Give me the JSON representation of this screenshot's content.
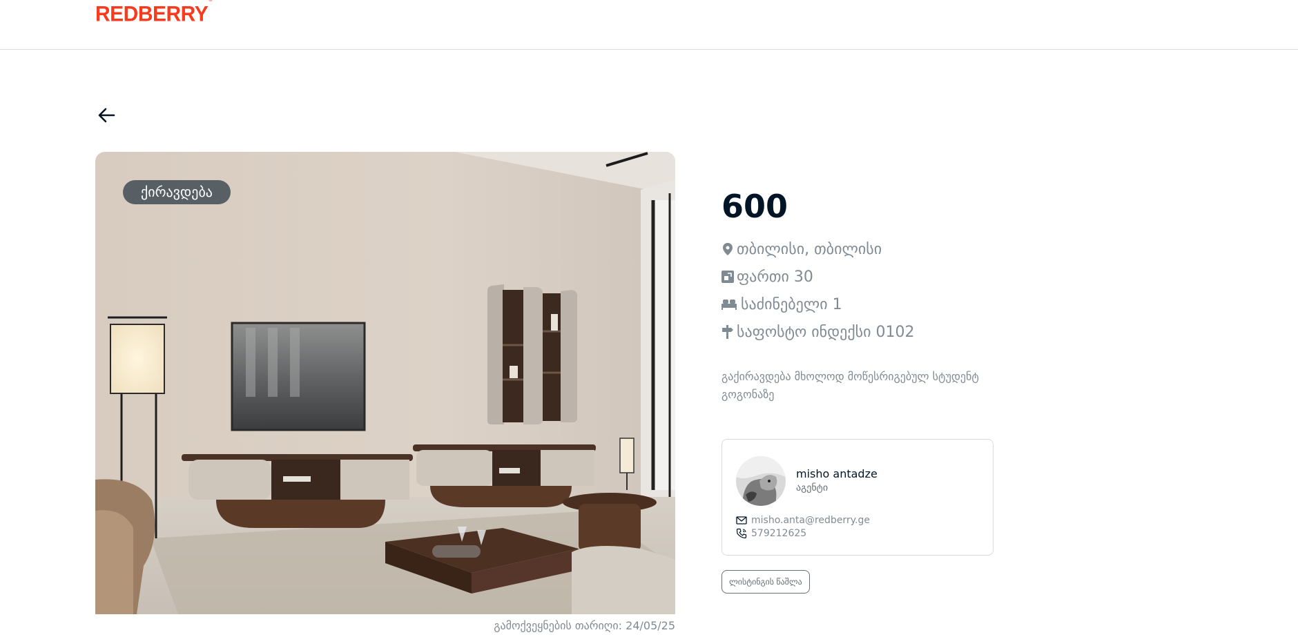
{
  "header": {
    "logo_text": "REDBERRY",
    "logo_mark": "®",
    "logo_color": "#f93b1d"
  },
  "nav": {
    "back_icon": "arrow-left-icon"
  },
  "listing": {
    "deal_type": "ქირავდება",
    "publish_date": "გამოქვეყნების თარიღი: 24/05/25",
    "price": "600",
    "location": "თბილისი, თბილისი",
    "area": "ფართი 30",
    "bedrooms": "საძინებელი 1",
    "zip": "საფოსტო ინდექსი 0102",
    "description": "გაქირავდება მხოლოდ მოწესრიგებულ სტუდენტ გოგონაზე"
  },
  "agent": {
    "name": "misho antadze",
    "role": "აგენტი",
    "email": "misho.anta@redberry.ge",
    "phone": "579212625"
  },
  "actions": {
    "delete_label": "ლისტინგის წაშლა"
  },
  "colors": {
    "text_primary": "#021526",
    "text_secondary": "#808a93",
    "border": "#dbdbdb",
    "badge_bg": "#021526"
  }
}
